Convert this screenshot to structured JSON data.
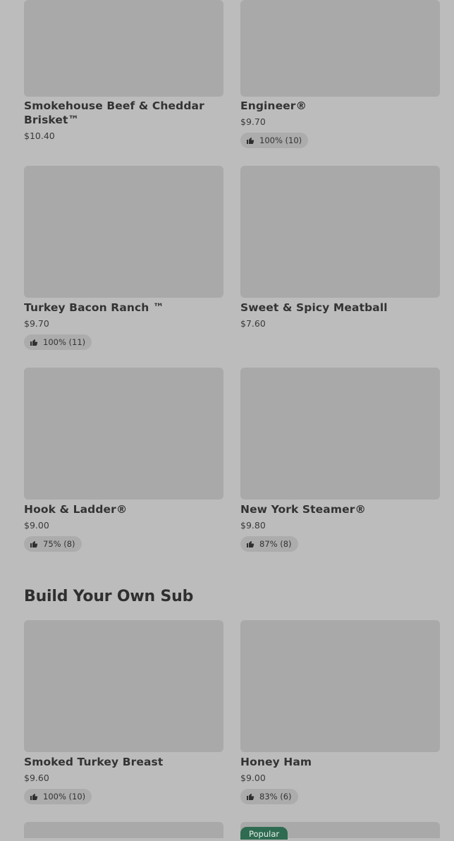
{
  "colors": {
    "background": "#bcbcbc",
    "image_placeholder": "#a9a9a9",
    "badge_bg": "#acacac",
    "popular_bg": "#2e6b51"
  },
  "menu": {
    "items": [
      {
        "name": "Smokehouse Beef & Cheddar Brisket™",
        "price": "$10.40"
      },
      {
        "name": "Engineer®",
        "price": "$9.70",
        "rating": "100% (10)"
      },
      {
        "name": "Turkey Bacon Ranch ™",
        "price": "$9.70",
        "rating": "100% (11)"
      },
      {
        "name": "Sweet & Spicy Meatball",
        "price": "$7.60"
      },
      {
        "name": "Hook & Ladder®",
        "price": "$9.00",
        "rating": "75% (8)"
      },
      {
        "name": "New York Steamer®",
        "price": "$9.80",
        "rating": "87% (8)"
      }
    ]
  },
  "build_your_own": {
    "title": "Build Your Own Sub",
    "items": [
      {
        "name": "Smoked Turkey Breast",
        "price": "$9.60",
        "rating": "100% (10)"
      },
      {
        "name": "Honey Ham",
        "price": "$9.00",
        "rating": "83% (6)"
      }
    ],
    "popular_label": "Popular"
  },
  "icons": {
    "rating": "thumbs-up-icon"
  }
}
